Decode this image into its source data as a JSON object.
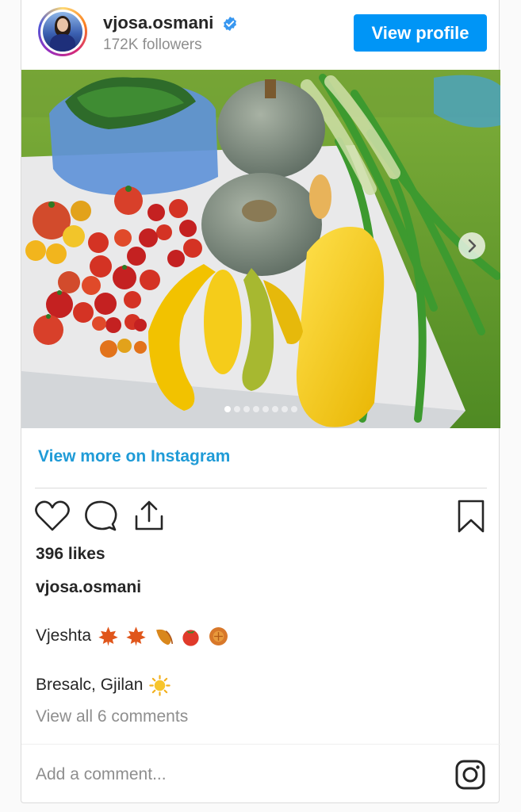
{
  "header": {
    "username": "vjosa.osmani",
    "followers": "172K followers",
    "view_profile_label": "View profile",
    "verified_color": "#3897f0"
  },
  "post": {
    "carousel": {
      "slides": 8,
      "active_index": 0
    },
    "view_more_label": "View more on Instagram",
    "likes": "396 likes",
    "caption_user": "vjosa.osmani",
    "caption_line1": "Vjeshta",
    "caption_line1_emojis": [
      "maple-leaf",
      "maple-leaf",
      "fallen-leaf",
      "tomato",
      "moon-cake"
    ],
    "caption_line2": "Bresalc, Gjilan",
    "caption_line2_emojis": [
      "sun"
    ],
    "comments_link": "View all 6 comments"
  },
  "actions": {
    "icons": [
      "heart-icon",
      "comment-icon",
      "share-icon",
      "bookmark-icon"
    ]
  },
  "comment_box": {
    "placeholder": "Add a comment..."
  },
  "colors": {
    "accent": "#0095f6",
    "link": "#1f9bd7"
  }
}
